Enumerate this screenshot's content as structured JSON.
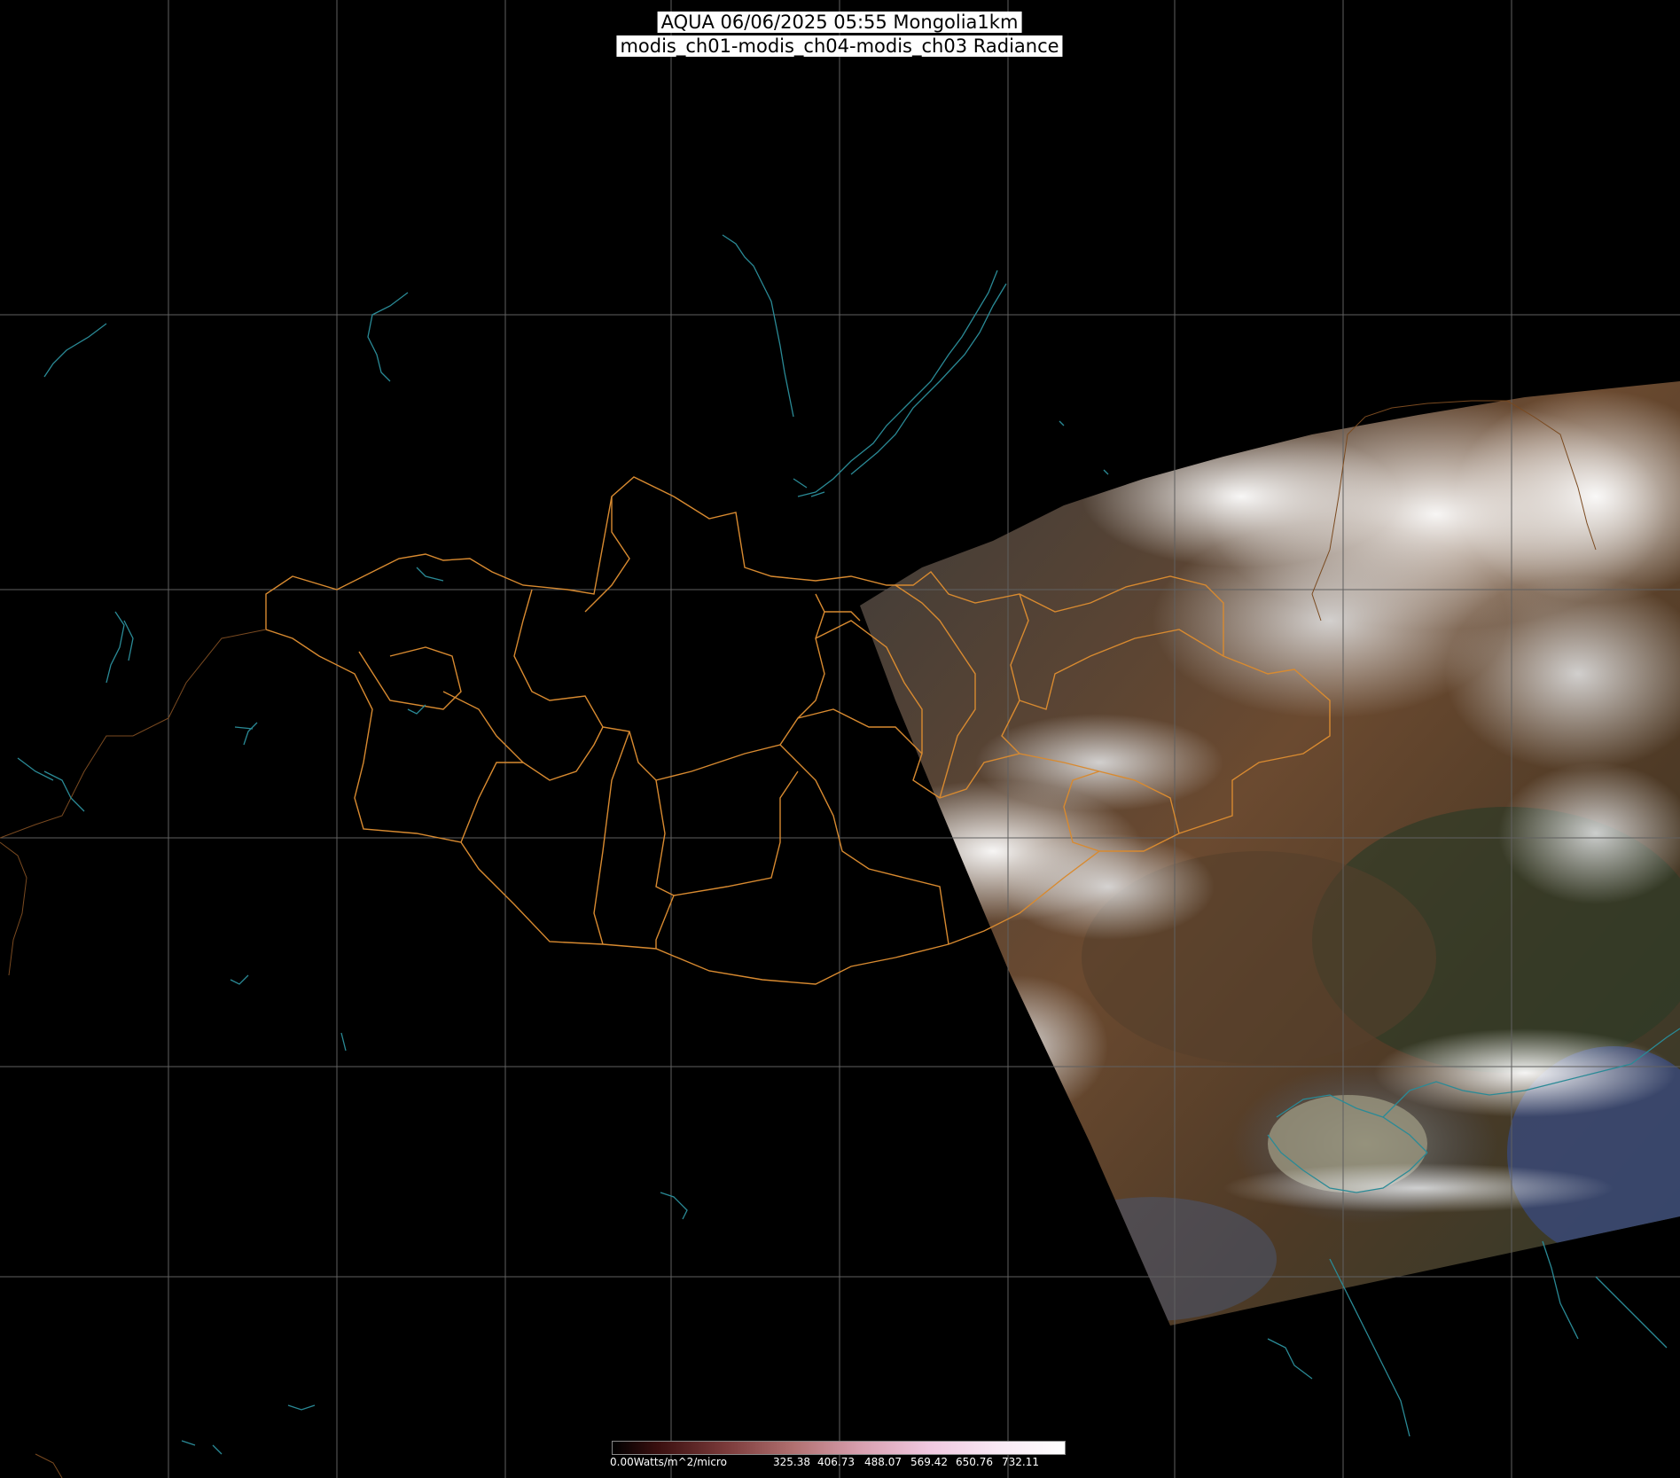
{
  "title": {
    "line1": "AQUA 06/06/2025 05:55 Mongolia1km",
    "line2": "modis_ch01-modis_ch04-modis_ch03 Radiance"
  },
  "colorbar": {
    "min_label": "0.00Watts/m^2/micro",
    "ticks": [
      "325.38",
      "406.73",
      "488.07",
      "569.42",
      "650.76",
      "732.11"
    ]
  },
  "colors": {
    "background": "#000000",
    "grid": "#606060",
    "boundaries": "#d88a30",
    "coastline": "#2a8a96",
    "colorbar_border": "#888888"
  }
}
